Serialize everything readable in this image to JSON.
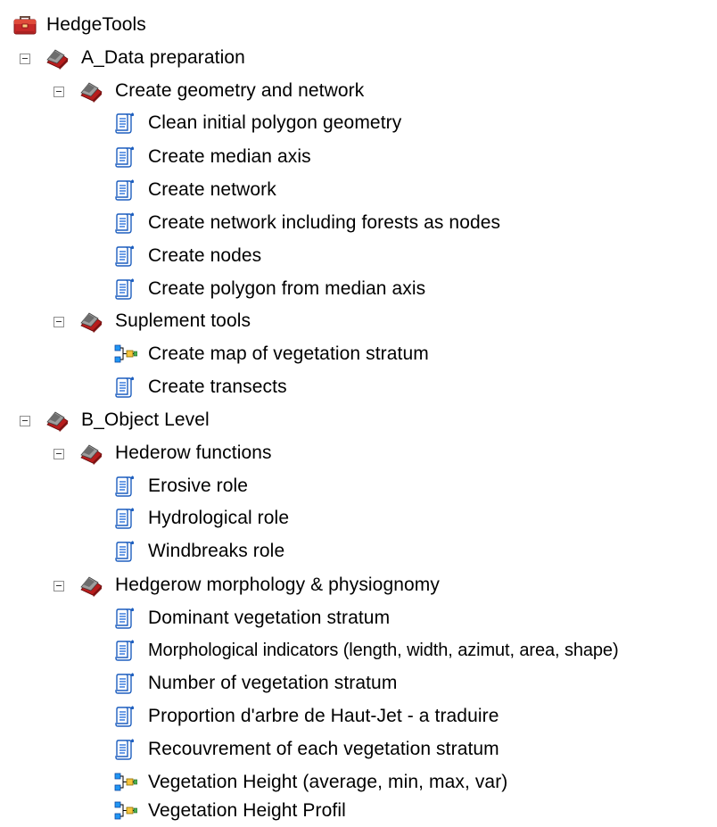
{
  "toolbox": {
    "title": "HedgeTools",
    "icon": "toolbox-icon",
    "toolsets": [
      {
        "label": "A_Data preparation",
        "icon": "toolset-icon",
        "expanded": true,
        "subsets": [
          {
            "label": "Create geometry and network",
            "icon": "toolset-icon",
            "expanded": true,
            "tools": [
              {
                "label": "Clean initial polygon geometry",
                "icon": "script-tool-icon"
              },
              {
                "label": "Create median axis",
                "icon": "script-tool-icon"
              },
              {
                "label": "Create network",
                "icon": "script-tool-icon"
              },
              {
                "label": "Create network including forests as nodes",
                "icon": "script-tool-icon"
              },
              {
                "label": "Create nodes",
                "icon": "script-tool-icon"
              },
              {
                "label": "Create polygon from median axis",
                "icon": "script-tool-icon"
              }
            ]
          },
          {
            "label": "Suplement tools",
            "icon": "toolset-icon",
            "expanded": true,
            "tools": [
              {
                "label": "Create map of vegetation stratum",
                "icon": "model-tool-icon"
              },
              {
                "label": "Create transects",
                "icon": "script-tool-icon"
              }
            ]
          }
        ]
      },
      {
        "label": "B_Object Level",
        "icon": "toolset-icon",
        "expanded": true,
        "subsets": [
          {
            "label": "Hederow functions",
            "icon": "toolset-icon",
            "expanded": true,
            "tools": [
              {
                "label": "Erosive role",
                "icon": "script-tool-icon"
              },
              {
                "label": "Hydrological role",
                "icon": "script-tool-icon"
              },
              {
                "label": "Windbreaks role",
                "icon": "script-tool-icon"
              }
            ]
          },
          {
            "label": "Hedgerow morphology & physiognomy",
            "icon": "toolset-icon",
            "expanded": true,
            "tools": [
              {
                "label": "Dominant vegetation stratum",
                "icon": "script-tool-icon"
              },
              {
                "label": "Morphological indicators (length, width, azimut, area, shape)",
                "icon": "script-tool-icon"
              },
              {
                "label": "Number of vegetation stratum",
                "icon": "script-tool-icon"
              },
              {
                "label": "Proportion d'arbre de Haut-Jet - a traduire",
                "icon": "script-tool-icon"
              },
              {
                "label": "Recouvrement of each vegetation stratum",
                "icon": "script-tool-icon"
              },
              {
                "label": "Vegetation Height (average, min, max, var)",
                "icon": "model-tool-icon"
              },
              {
                "label": "Vegetation Height Profil",
                "icon": "model-tool-icon"
              }
            ]
          }
        ]
      }
    ]
  }
}
